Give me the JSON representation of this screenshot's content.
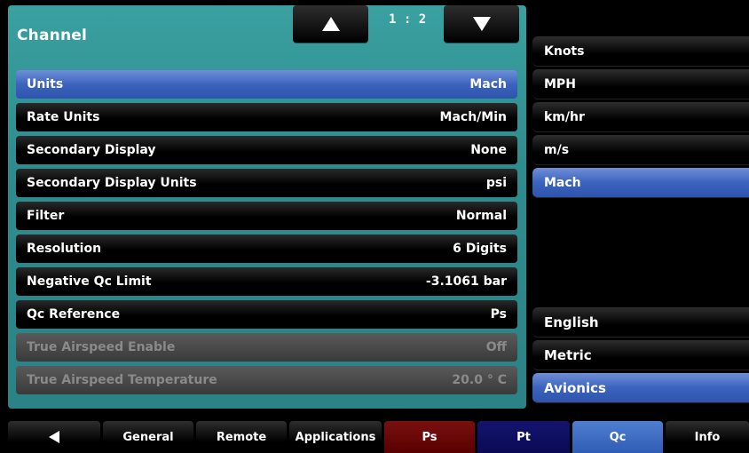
{
  "header": {
    "title": "Channel",
    "page_indicator": "1 : 2",
    "up_icon": "up-arrow-icon",
    "down_icon": "down-arrow-icon"
  },
  "settings": [
    {
      "label": "Units",
      "value": "Mach",
      "state": "selected"
    },
    {
      "label": "Rate Units",
      "value": "Mach/Min",
      "state": "normal"
    },
    {
      "label": "Secondary Display",
      "value": "None",
      "state": "normal"
    },
    {
      "label": "Secondary Display Units",
      "value": "psi",
      "state": "normal"
    },
    {
      "label": "Filter",
      "value": "Normal",
      "state": "normal"
    },
    {
      "label": "Resolution",
      "value": "6 Digits",
      "state": "normal"
    },
    {
      "label": "Negative Qc Limit",
      "value": "-3.1061 bar",
      "state": "normal"
    },
    {
      "label": "Qc Reference",
      "value": "Ps",
      "state": "normal"
    },
    {
      "label": "True Airspeed Enable",
      "value": "Off",
      "state": "disabled"
    },
    {
      "label": "True Airspeed Temperature",
      "value": "20.0 ° C",
      "state": "disabled"
    }
  ],
  "unit_options": [
    {
      "label": "Knots",
      "selected": false
    },
    {
      "label": "MPH",
      "selected": false
    },
    {
      "label": "km/hr",
      "selected": false
    },
    {
      "label": "m/s",
      "selected": false
    },
    {
      "label": "Mach",
      "selected": true
    }
  ],
  "unit_systems": [
    {
      "label": "English",
      "selected": false
    },
    {
      "label": "Metric",
      "selected": false
    },
    {
      "label": "Avionics",
      "selected": true
    }
  ],
  "tabs": [
    {
      "label": "General"
    },
    {
      "label": "Remote"
    },
    {
      "label": "Applications"
    },
    {
      "label": "Ps"
    },
    {
      "label": "Pt"
    },
    {
      "label": "Qc"
    },
    {
      "label": "Info"
    }
  ],
  "colors": {
    "panel": "#2f8c8e",
    "selected": "#3c63bd",
    "ps_tab": "#6a0000",
    "pt_tab": "#0f0f60",
    "qc_tab": "#3f6cc3"
  }
}
